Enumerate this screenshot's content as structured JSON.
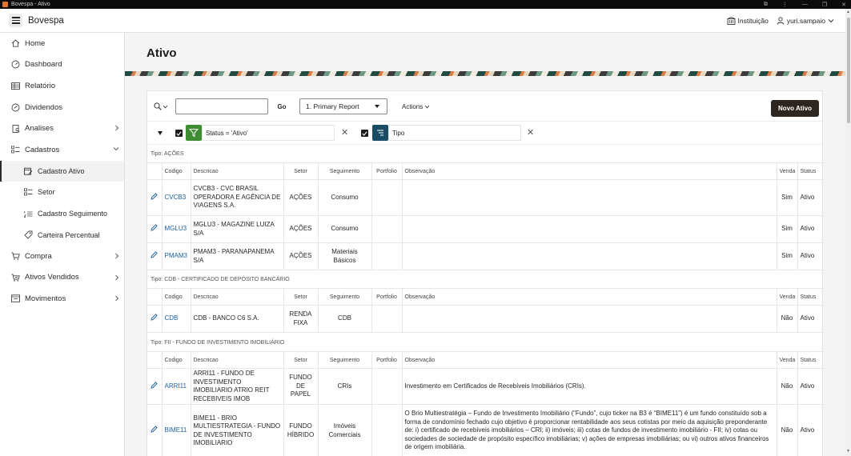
{
  "window": {
    "title": "Bovespa - Ativo"
  },
  "header": {
    "app_title": "Bovespa",
    "institution": "Instituição",
    "user": "yuri.sampaio"
  },
  "sidebar": {
    "items": [
      {
        "label": "Home"
      },
      {
        "label": "Dashboard"
      },
      {
        "label": "Relatório"
      },
      {
        "label": "Dividendos"
      },
      {
        "label": "Analises"
      },
      {
        "label": "Cadastros"
      },
      {
        "label": "Cadastro Ativo"
      },
      {
        "label": "Setor"
      },
      {
        "label": "Cadastro Seguimento"
      },
      {
        "label": "Carteira Percentual"
      },
      {
        "label": "Compra"
      },
      {
        "label": "Ativos Vendidos"
      },
      {
        "label": "Movimentos"
      }
    ]
  },
  "page": {
    "title": "Ativo"
  },
  "toolbar": {
    "search_value": "",
    "go_label": "Go",
    "report_label": "1. Primary Report",
    "actions_label": "Actions",
    "new_label": "Novo Ativo"
  },
  "filters": {
    "status": "Status = 'Ativo'",
    "group": "Tipo"
  },
  "columns": {
    "codigo": "Codigo",
    "descricao": "Descricao",
    "setor": "Setor",
    "seguimento": "Seguimento",
    "portfolio": "Portfolio",
    "observacao": "Observação",
    "venda": "Venda",
    "status": "Status"
  },
  "groups": [
    {
      "label": "Tipo: AÇÕES",
      "rows": [
        {
          "codigo": "CVCB3",
          "descricao": "CVCB3 - CVC BRASIL OPERADORA E AGÊNCIA DE VIAGENS S.A.",
          "setor": "AÇÕES",
          "seguimento": "Consumo",
          "portfolio": "",
          "observacao": "",
          "venda": "Sim",
          "status": "Ativo"
        },
        {
          "codigo": "MGLU3",
          "descricao": "MGLU3 - MAGAZINE LUIZA S/A",
          "setor": "AÇÕES",
          "seguimento": "Consumo",
          "portfolio": "",
          "observacao": "",
          "venda": "Sim",
          "status": "Ativo"
        },
        {
          "codigo": "PMAM3",
          "descricao": "PMAM3 - PARANAPANEMA S/A",
          "setor": "AÇÕES",
          "seguimento": "Materiais Básicos",
          "portfolio": "",
          "observacao": "",
          "venda": "Sim",
          "status": "Ativo"
        }
      ]
    },
    {
      "label": "Tipo: CDB - CERTIFICADO DE DEPÓSITO BANCÁRIO",
      "rows": [
        {
          "codigo": "CDB",
          "descricao": "CDB - BANCO C6 S.A.",
          "setor": "RENDA FIXA",
          "seguimento": "CDB",
          "portfolio": "",
          "observacao": "",
          "venda": "Não",
          "status": "Ativo"
        }
      ]
    },
    {
      "label": "Tipo: FII - FUNDO DE INVESTIMENTO IMOBILIÁRIO",
      "rows": [
        {
          "codigo": "ARRI11",
          "descricao": "ARRI11 - FUNDO DE INVESTIMENTO IMOBILIARIO ATRIO REIT RECEBIVEIS IMOB",
          "setor": "FUNDO DE PAPEL",
          "seguimento": "CRIs",
          "portfolio": "",
          "observacao": "Investimento em Certificados de Recebíveis Imobiliários (CRIs).",
          "venda": "Não",
          "status": "Ativo"
        },
        {
          "codigo": "BIME11",
          "descricao": "BIME11 - BRIO MULTIESTRATEGIA - FUNDO DE INVESTIMENTO IMOBILIARIO",
          "setor": "FUNDO HÍBRIDO",
          "seguimento": "Imóveis Comerciais",
          "portfolio": "",
          "observacao": "O Brio Multiestratégia – Fundo de Investimento Imobiliário (“Fundo”, cujo ticker na B3 é “BIME11”) é um fundo constituído sob a forma de condomínio fechado cujo objetivo é proporcionar rentabilidade aos seus cotistas por meio da aquisição preponderante de: i) certificado de recebíveis imobiliários – CRI; ii) imóveis; iii) cotas de fundos de investimento imobiliário - FII; iv) cotas ou sociedades de sociedade de propósito específico imobiliárias; v) ações de empresas imobiliárias; ou vi) outros ativos financeiros de origem imobiliária.",
          "venda": "Não",
          "status": "Ativo"
        }
      ]
    }
  ]
}
